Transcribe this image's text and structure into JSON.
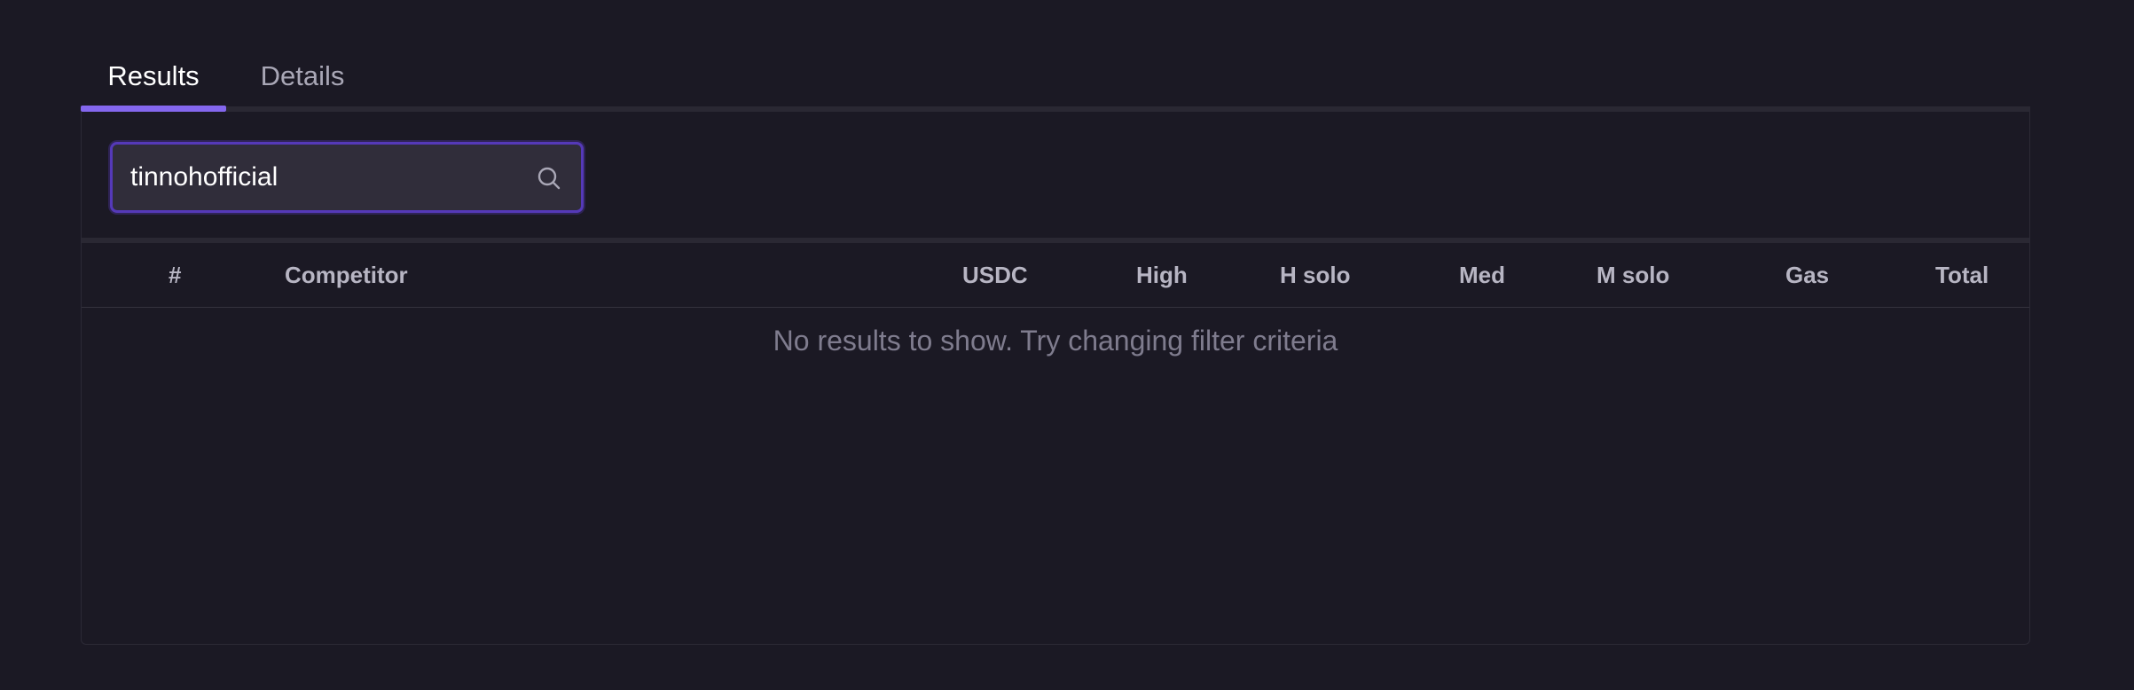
{
  "tabs": [
    {
      "label": "Results",
      "active": true
    },
    {
      "label": "Details",
      "active": false
    }
  ],
  "search": {
    "value": "tinnohofficial",
    "icon": "search-icon"
  },
  "table": {
    "columns": [
      "#",
      "Competitor",
      "USDC",
      "High",
      "H solo",
      "Med",
      "M solo",
      "Gas",
      "Total"
    ],
    "rows": [],
    "empty_message": "No results to show. Try changing filter criteria"
  },
  "colors": {
    "background": "#1b1924",
    "accent": "#8467ee",
    "input_border": "#5539b8"
  }
}
